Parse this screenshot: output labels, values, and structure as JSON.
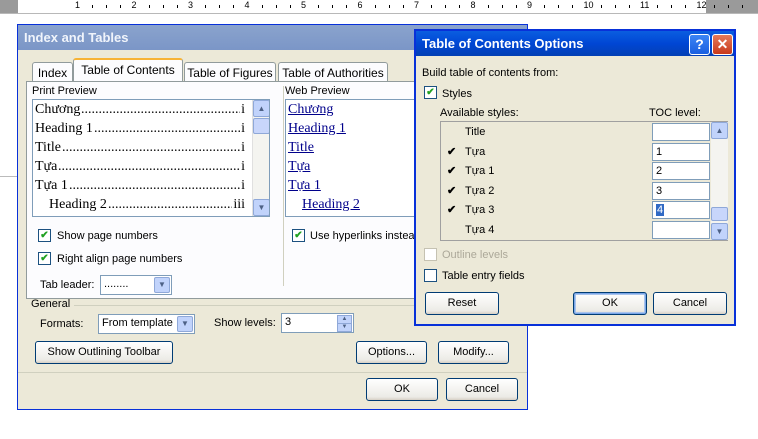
{
  "ruler": {
    "numbers": [
      "1",
      "2",
      "3",
      "4",
      "5",
      "6",
      "7",
      "8",
      "9",
      "10",
      "11",
      "12"
    ]
  },
  "main": {
    "title": "Index and Tables",
    "tabs": [
      {
        "label": "Index",
        "active": false
      },
      {
        "label": "Table of Contents",
        "active": true
      },
      {
        "label": "Table of Figures",
        "active": false
      },
      {
        "label": "Table of Authorities",
        "active": false
      }
    ],
    "print_preview": {
      "label": "Print Preview",
      "lines": [
        {
          "text": "Chương",
          "page": "i"
        },
        {
          "text": "Heading 1",
          "page": "i"
        },
        {
          "text": "Title",
          "page": "i"
        },
        {
          "text": "Tựa",
          "page": "i"
        },
        {
          "text": "Tựa 1",
          "page": "i"
        },
        {
          "text": "Heading 2",
          "page": "iii"
        }
      ]
    },
    "web_preview": {
      "label": "Web Preview",
      "links": [
        "Chương",
        "Heading 1",
        "Title",
        "Tựa",
        "Tựa 1",
        "Heading 2"
      ]
    },
    "show_page_numbers": {
      "label": "Show page numbers",
      "checked": true
    },
    "right_align": {
      "label": "Right align page numbers",
      "checked": true
    },
    "tab_leader": {
      "label": "Tab leader:",
      "value": "........"
    },
    "use_hyperlinks": {
      "label": "Use hyperlinks instead",
      "checked": true
    },
    "general_label": "General",
    "formats": {
      "label": "Formats:",
      "value": "From template"
    },
    "show_levels": {
      "label": "Show levels:",
      "value": "3"
    },
    "buttons": {
      "outlining": "Show Outlining Toolbar",
      "options": "Options...",
      "modify": "Modify...",
      "ok": "OK",
      "cancel": "Cancel"
    }
  },
  "options_dialog": {
    "title": "Table of Contents Options",
    "help_glyph": "?",
    "close_glyph": "✕",
    "build_label": "Build table of contents from:",
    "styles": {
      "label": "Styles",
      "checked": true
    },
    "available_styles_header": "Available styles:",
    "toc_level_header": "TOC level:",
    "style_rows": [
      {
        "name": "Title",
        "checked": false,
        "level": ""
      },
      {
        "name": "Tựa",
        "checked": true,
        "level": "1"
      },
      {
        "name": "Tựa 1",
        "checked": true,
        "level": "2"
      },
      {
        "name": "Tựa 2",
        "checked": true,
        "level": "3"
      },
      {
        "name": "Tựa 3",
        "checked": true,
        "level": "4"
      },
      {
        "name": "Tựa 4",
        "checked": false,
        "level": ""
      }
    ],
    "outline_levels": {
      "label": "Outline levels",
      "checked": false,
      "disabled": true
    },
    "table_entry_fields": {
      "label": "Table entry fields",
      "checked": false
    },
    "buttons": {
      "reset": "Reset",
      "ok": "OK",
      "cancel": "Cancel"
    }
  }
}
